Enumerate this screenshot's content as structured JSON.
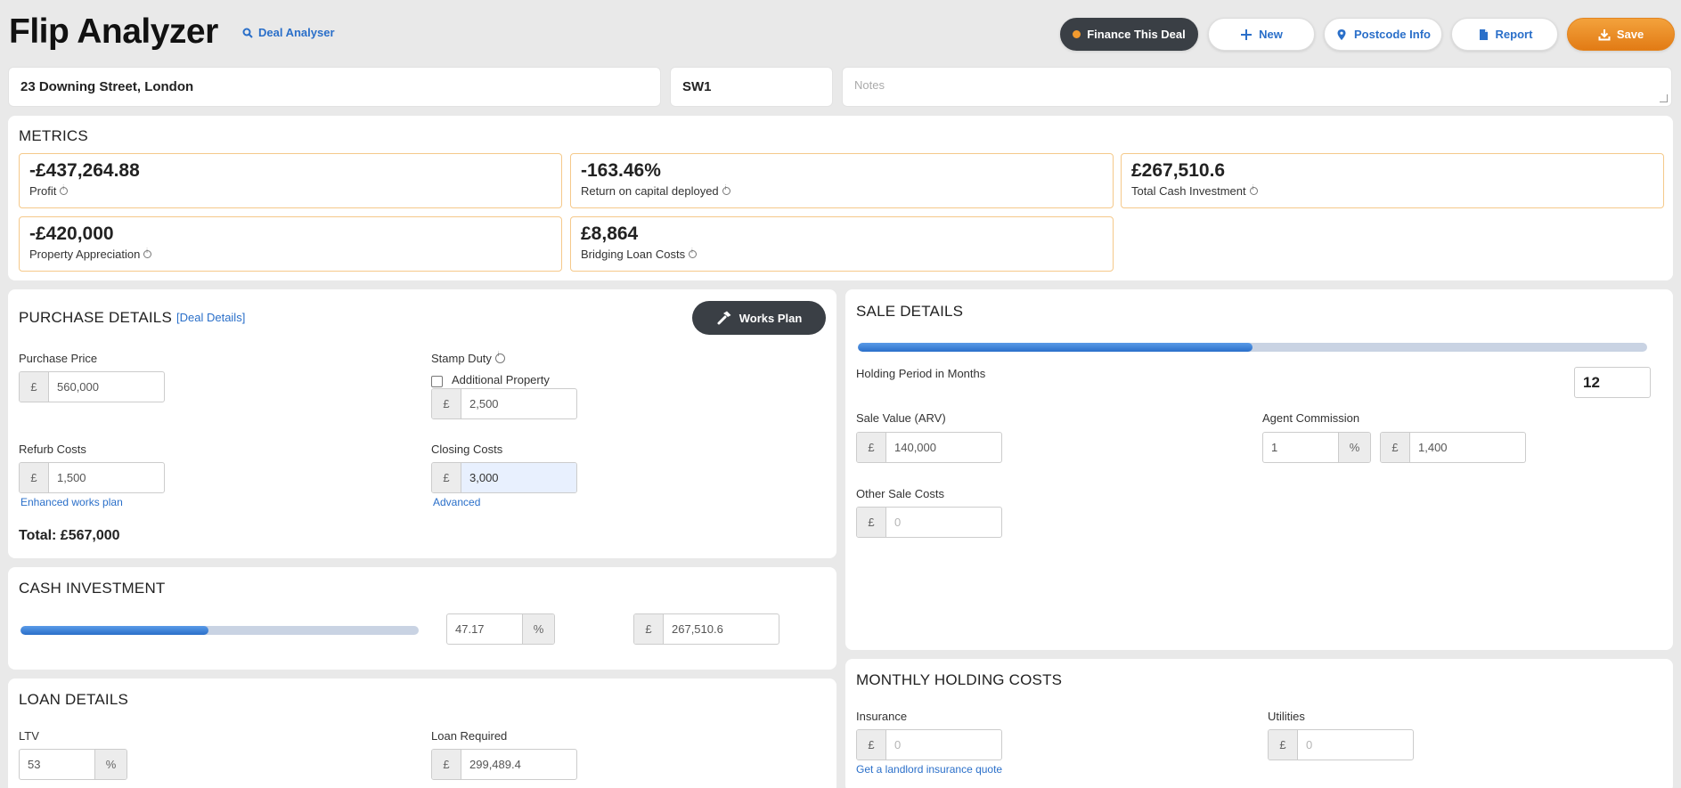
{
  "header": {
    "title": "Flip Analyzer",
    "deal_link": "Deal Analyser",
    "buttons": {
      "finance": "Finance This Deal",
      "new": "New",
      "postcode": "Postcode Info",
      "report": "Report",
      "save": "Save"
    }
  },
  "top": {
    "address": "23 Downing Street, London",
    "postcode": "SW1",
    "notes_placeholder": "Notes"
  },
  "metrics": {
    "title": "METRICS",
    "items": [
      {
        "value": "-£437,264.88",
        "label": "Profit"
      },
      {
        "value": "-163.46%",
        "label": "Return on capital deployed"
      },
      {
        "value": "£267,510.6",
        "label": "Total Cash Investment"
      },
      {
        "value": "-£420,000",
        "label": "Property Appreciation"
      },
      {
        "value": "£8,864",
        "label": "Bridging Loan Costs"
      }
    ]
  },
  "purchase": {
    "title": "PURCHASE DETAILS",
    "deal_details_link": "[Deal Details]",
    "works_plan": "Works Plan",
    "purchase_price_label": "Purchase Price",
    "purchase_price": "560,000",
    "stamp_duty_label": "Stamp Duty",
    "additional_property_label": "Additional Property",
    "stamp_duty": "2,500",
    "refurb_label": "Refurb Costs",
    "refurb": "1,500",
    "enhanced_link": "Enhanced works plan",
    "closing_label": "Closing Costs",
    "closing": "3,000",
    "advanced_link": "Advanced",
    "total": "Total: £567,000",
    "currency": "£"
  },
  "sale": {
    "title": "SALE DETAILS",
    "holding_progress": 0.5,
    "holding_label": "Holding Period in Months",
    "holding_value": "12",
    "sale_value_label": "Sale Value (ARV)",
    "sale_value": "140,000",
    "agent_label": "Agent Commission",
    "agent_pct": "1",
    "agent_value": "1,400",
    "other_label": "Other Sale Costs",
    "other_placeholder": "0",
    "currency": "£",
    "pct": "%"
  },
  "cash": {
    "title": "CASH INVESTMENT",
    "progress": 0.4717,
    "percent": "47.17",
    "amount": "267,510.6",
    "currency": "£",
    "pct": "%"
  },
  "loan": {
    "title": "LOAN DETAILS",
    "ltv_label": "LTV",
    "ltv": "53",
    "loan_label": "Loan Required",
    "loan": "299,489.4",
    "currency": "£",
    "pct": "%"
  },
  "holding": {
    "title": "MONTHLY HOLDING COSTS",
    "insurance_label": "Insurance",
    "insurance_placeholder": "0",
    "insurance_link": "Get a landlord insurance quote",
    "utilities_label": "Utilities",
    "utilities_placeholder": "0",
    "currency": "£"
  },
  "colors": {
    "accent": "#2a6fc9",
    "orange": "#e27b15",
    "dark_button": "#3a3f45"
  }
}
